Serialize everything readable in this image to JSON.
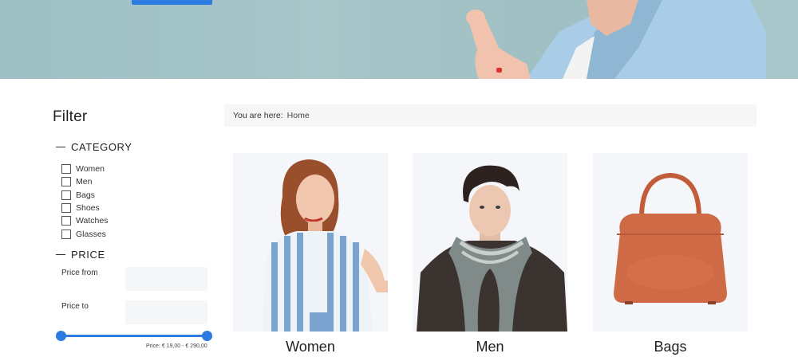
{
  "hero": {
    "cta_label": ""
  },
  "filter": {
    "title": "Filter",
    "category": {
      "heading": "CATEGORY",
      "items": [
        "Women",
        "Men",
        "Bags",
        "Shoes",
        "Watches",
        "Glasses"
      ]
    },
    "price": {
      "heading": "PRICE",
      "from_label": "Price from",
      "to_label": "Price to",
      "from_value": "",
      "to_value": "",
      "range_text": "Price: € 19,00 - € 290,00",
      "slider_min_fraction": 0,
      "slider_max_fraction": 1
    }
  },
  "breadcrumb": {
    "prefix": "You are here:",
    "current": "Home"
  },
  "categories": [
    {
      "label": "Women"
    },
    {
      "label": "Men"
    },
    {
      "label": "Bags"
    }
  ],
  "colors": {
    "accent": "#2d7be0",
    "hero_bg": "#a2c2c5",
    "card_bg": "#f4f6f9",
    "bag": "#cf6a46"
  }
}
